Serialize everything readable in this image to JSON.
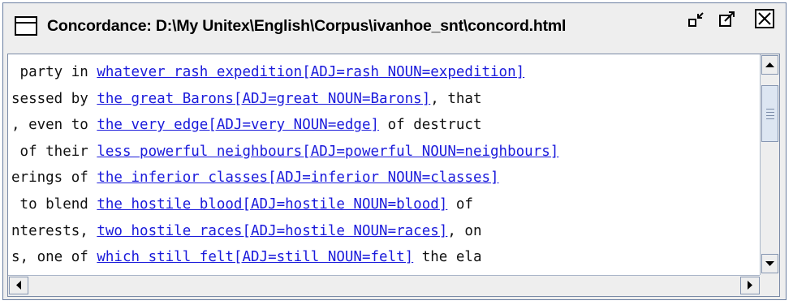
{
  "window": {
    "title": "Concordance: D:\\My Unitex\\English\\Corpus\\ivanhoe_snt\\concord.html",
    "icons": {
      "window": "window-icon",
      "minimize": "minimize-icon",
      "maximize": "maximize-icon",
      "close": "close-icon"
    }
  },
  "concordance": {
    "lines": [
      {
        "left": " party in ",
        "match": "whatever rash expedition[ADJ=rash NOUN=expedition]",
        "right": ""
      },
      {
        "left": "sessed by ",
        "match": "the great Barons[ADJ=great NOUN=Barons]",
        "right": ", that"
      },
      {
        "left": ", even to ",
        "match": "the very edge[ADJ=very NOUN=edge]",
        "right": " of destruct"
      },
      {
        "left": " of their ",
        "match": "less powerful neighbours[ADJ=powerful NOUN=neighbours]",
        "right": ""
      },
      {
        "left": "erings of ",
        "match": "the inferior classes[ADJ=inferior NOUN=classes]",
        "right": ""
      },
      {
        "left": " to blend ",
        "match": "the hostile blood[ADJ=hostile NOUN=blood]",
        "right": " of"
      },
      {
        "left": "nterests, ",
        "match": "two hostile races[ADJ=hostile NOUN=races]",
        "right": ", on"
      },
      {
        "left": "s, one of ",
        "match": "which still felt[ADJ=still NOUN=felt]",
        "right": " the ela"
      }
    ]
  },
  "scrollbars": {
    "icons": {
      "up": "arrow-up-icon",
      "down": "arrow-down-icon",
      "left": "arrow-left-icon",
      "right": "arrow-right-icon"
    }
  },
  "colors": {
    "link": "#1a1adb",
    "frame_bg": "#eeeeee",
    "content_bg": "#ffffff"
  }
}
